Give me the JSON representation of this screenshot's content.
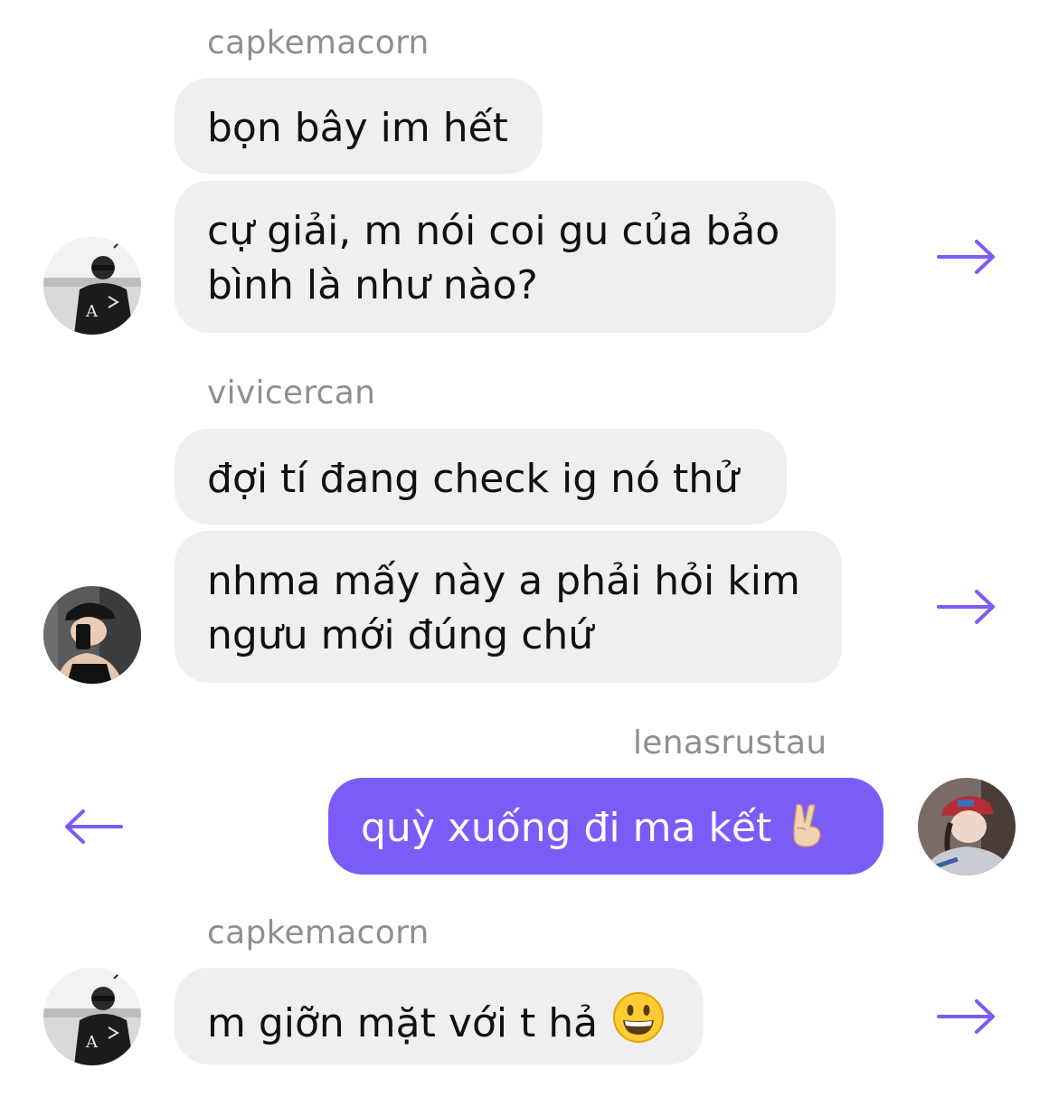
{
  "messages": [
    {
      "sender": "capkemacorn",
      "bubbles": [
        "bọn bây im hết",
        "cự giải, m nói coi gu của bảo",
        "bình là như nào?"
      ]
    },
    {
      "sender": "vivicercan",
      "bubbles": [
        "đợi tí đang check ig nó thử",
        "nhma mấy này a phải hỏi kim",
        "ngưu mới đúng chứ"
      ]
    },
    {
      "sender": "lenasrustau",
      "bubbles": [
        "quỳ xuống đi ma kết"
      ],
      "emoji": "victory-hand-emoji"
    },
    {
      "sender": "capkemacorn",
      "bubbles": [
        "m giỡn mặt với t hả"
      ],
      "emoji": "grinning-face-emoji"
    }
  ],
  "icons": {
    "forward": "arrow-right-icon",
    "reply": "arrow-left-icon"
  },
  "colors": {
    "incoming_bubble": "#efeff2",
    "outgoing_bubble": "#7b5cf7",
    "accent_arrow": "#7b5cf7",
    "sender_name": "#8e8e93"
  }
}
